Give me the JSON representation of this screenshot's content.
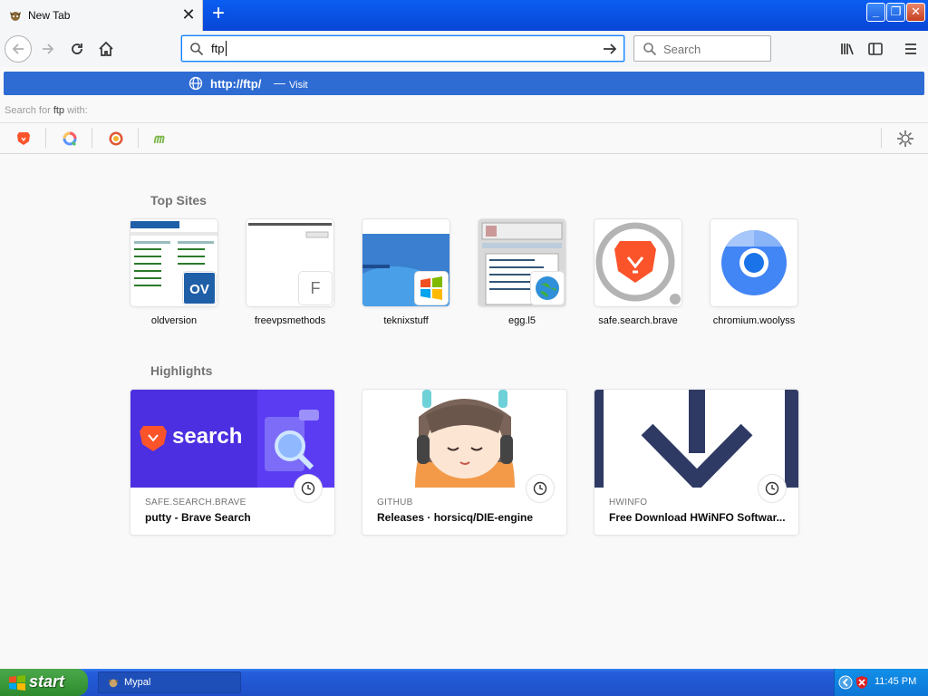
{
  "tab": {
    "title": "New Tab",
    "close_glyph": "✕"
  },
  "newtab": {
    "glyph": "+"
  },
  "window": {
    "minimize": "_",
    "restore": "❐",
    "close": "✕"
  },
  "urlbar": {
    "value": "ftp"
  },
  "searchbar": {
    "placeholder": "Search"
  },
  "autocomplete": {
    "url": "http://ftp/",
    "separator": "—",
    "action": "Visit",
    "search_for_prefix": "Search for",
    "search_for_term": "ftp",
    "search_for_suffix": "with:"
  },
  "top_sites": {
    "title": "Top Sites",
    "items": [
      {
        "label": "oldversion"
      },
      {
        "label": "freevpsmethods",
        "badge_letter": "F"
      },
      {
        "label": "teknixstuff"
      },
      {
        "label": "egg.l5"
      },
      {
        "label": "safe.search.brave"
      },
      {
        "label": "chromium.woolyss"
      }
    ]
  },
  "highlights": {
    "title": "Highlights",
    "items": [
      {
        "source": "SAFE.SEARCH.BRAVE",
        "title": "putty - Brave Search",
        "image_text": "search"
      },
      {
        "source": "GITHUB",
        "title": "Releases · horsicq/DIE-engine"
      },
      {
        "source": "HWINFO",
        "title": "Free Download HWiNFO Softwar..."
      }
    ]
  },
  "taskbar": {
    "start_label": "start",
    "task_label": "Mypal",
    "clock": "11:45 PM"
  }
}
